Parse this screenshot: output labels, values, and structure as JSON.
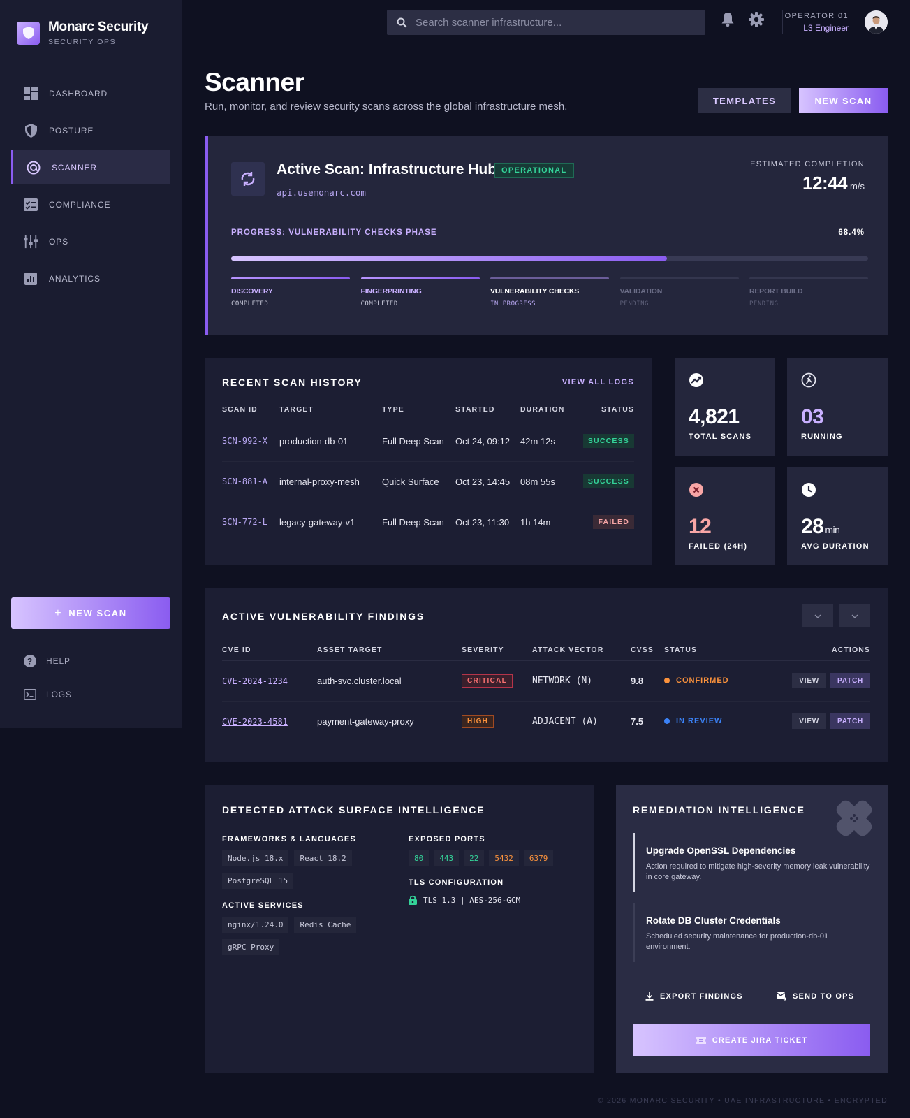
{
  "brand": {
    "title": "Monarc Security",
    "subtitle": "SECURITY OPS"
  },
  "sidebar": {
    "items": [
      {
        "label": "DASHBOARD",
        "icon": "dashboard-icon"
      },
      {
        "label": "POSTURE",
        "icon": "shield-icon"
      },
      {
        "label": "SCANNER",
        "icon": "scanner-icon",
        "active": true
      },
      {
        "label": "COMPLIANCE",
        "icon": "checklist-icon"
      },
      {
        "label": "OPS",
        "icon": "sliders-icon"
      },
      {
        "label": "ANALYTICS",
        "icon": "analytics-icon"
      }
    ],
    "new_scan": "NEW SCAN",
    "help": "HELP",
    "logs": "LOGS"
  },
  "topbar": {
    "search_placeholder": "Search scanner infrastructure...",
    "operator_name": "OPERATOR 01",
    "operator_role": "L3 Engineer"
  },
  "header": {
    "title": "Scanner",
    "subtitle": "Run, monitor, and review security scans across the global infrastructure mesh.",
    "templates": "TEMPLATES",
    "new_scan": "NEW SCAN"
  },
  "active_scan": {
    "title": "Active Scan: Infrastructure Hub",
    "status": "OPERATIONAL",
    "url": "api.usemonarc.com",
    "est_label": "ESTIMATED COMPLETION",
    "est_value": "12:44",
    "est_unit": "m/s",
    "progress_label": "PROGRESS: VULNERABILITY CHECKS PHASE",
    "progress_text": "68.4%",
    "progress_value": 68.4,
    "phases": [
      {
        "name": "DISCOVERY",
        "status": "COMPLETED",
        "state": "done"
      },
      {
        "name": "FINGERPRINTING",
        "status": "COMPLETED",
        "state": "done"
      },
      {
        "name": "VULNERABILITY CHECKS",
        "status": "IN PROGRESS",
        "state": "prog"
      },
      {
        "name": "VALIDATION",
        "status": "PENDING",
        "state": "pend"
      },
      {
        "name": "REPORT BUILD",
        "status": "PENDING",
        "state": "pend"
      }
    ]
  },
  "history": {
    "title": "RECENT SCAN HISTORY",
    "view_all": "VIEW ALL LOGS",
    "columns": [
      "SCAN ID",
      "TARGET",
      "TYPE",
      "STARTED",
      "DURATION",
      "STATUS"
    ],
    "rows": [
      {
        "id": "SCN-992-X",
        "target": "production-db-01",
        "type": "Full Deep Scan",
        "started": "Oct 24, 09:12",
        "duration": "42m 12s",
        "status": "SUCCESS",
        "ok": true
      },
      {
        "id": "SCN-881-A",
        "target": "internal-proxy-mesh",
        "type": "Quick Surface",
        "started": "Oct 23, 14:45",
        "duration": "08m 55s",
        "status": "SUCCESS",
        "ok": true
      },
      {
        "id": "SCN-772-L",
        "target": "legacy-gateway-v1",
        "type": "Full Deep Scan",
        "started": "Oct 23, 11:30",
        "duration": "1h 14m",
        "status": "FAILED",
        "ok": false
      }
    ]
  },
  "stats": {
    "total": {
      "value": "4,821",
      "label": "TOTAL SCANS",
      "color": "#ffffff"
    },
    "running": {
      "value": "03",
      "label": "RUNNING",
      "color": "#c9b0ff"
    },
    "failed": {
      "value": "12",
      "label": "FAILED (24H)",
      "color": "#f8a6a6"
    },
    "avg": {
      "value": "28",
      "unit": "min",
      "label": "AVG DURATION",
      "color": "#ffffff"
    }
  },
  "vulns": {
    "title": "ACTIVE VULNERABILITY FINDINGS",
    "columns": [
      "CVE ID",
      "ASSET TARGET",
      "SEVERITY",
      "ATTACK VECTOR",
      "CVSS",
      "STATUS",
      "ACTIONS"
    ],
    "rows": [
      {
        "cve": "CVE-2024-1234",
        "asset": "auth-svc.cluster.local",
        "severity": "CRITICAL",
        "sev_class": "crit",
        "vector": "NETWORK (N)",
        "cvss": "9.8",
        "status": "CONFIRMED",
        "status_color": "#fb923c"
      },
      {
        "cve": "CVE-2023-4581",
        "asset": "payment-gateway-proxy",
        "severity": "HIGH",
        "sev_class": "high",
        "vector": "ADJACENT (A)",
        "cvss": "7.5",
        "status": "IN REVIEW",
        "status_color": "#3b82f6"
      }
    ],
    "view": "VIEW",
    "patch": "PATCH"
  },
  "surface": {
    "title": "DETECTED ATTACK SURFACE INTELLIGENCE",
    "frameworks_label": "FRAMEWORKS & LANGUAGES",
    "frameworks": [
      "Node.js 18.x",
      "React 18.2",
      "PostgreSQL 15"
    ],
    "services_label": "ACTIVE SERVICES",
    "services": [
      "nginx/1.24.0",
      "Redis Cache",
      "gRPC Proxy"
    ],
    "ports_label": "EXPOSED PORTS",
    "ports": [
      {
        "port": "80",
        "color": "#34d399"
      },
      {
        "port": "443",
        "color": "#34d399"
      },
      {
        "port": "22",
        "color": "#34d399"
      },
      {
        "port": "5432",
        "color": "#fb923c"
      },
      {
        "port": "6379",
        "color": "#fb923c"
      }
    ],
    "tls_label": "TLS CONFIGURATION",
    "tls_value": "TLS 1.3 | AES-256-GCM"
  },
  "remediation": {
    "title": "REMEDIATION INTELLIGENCE",
    "items": [
      {
        "title": "Upgrade OpenSSL Dependencies",
        "desc": "Action required to mitigate high-severity memory leak vulnerability in core gateway."
      },
      {
        "title": "Rotate DB Cluster Credentials",
        "desc": "Scheduled security maintenance for production-db-01 environment."
      }
    ],
    "export": "EXPORT FINDINGS",
    "send": "SEND TO OPS",
    "jira": "CREATE JIRA TICKET"
  },
  "footer": "© 2026 MONARC SECURITY • UAE INFRASTRUCTURE • ENCRYPTED"
}
